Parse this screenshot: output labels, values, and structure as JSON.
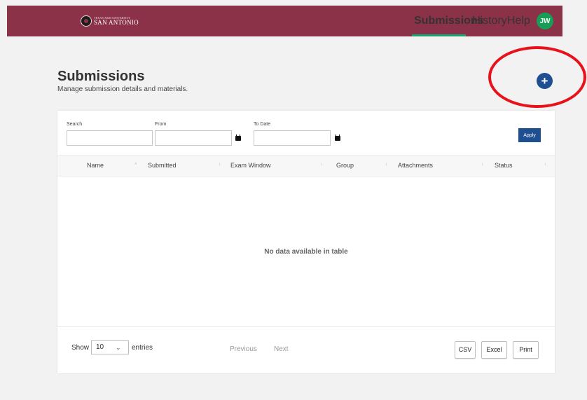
{
  "header": {
    "logo_small": "Texas A&M University",
    "logo_main": "SAN ANTONIO",
    "nav": {
      "submissions": "Submissions",
      "history": "History",
      "help": "Help"
    },
    "user_initials": "JW",
    "colors": {
      "bar": "#8c3248",
      "active": "#17a673",
      "avatar": "#159e55"
    }
  },
  "page": {
    "title": "Submissions",
    "subtitle": "Manage submission details and materials.",
    "add_button": "+"
  },
  "filters": {
    "search_label": "Search",
    "from_label": "From",
    "to_label": "To Date",
    "search_value": "",
    "from_value": "",
    "to_value": "",
    "apply_label": "Apply"
  },
  "table": {
    "columns": [
      "Name",
      "Submitted",
      "Exam Window",
      "Group",
      "Attachments",
      "Status"
    ],
    "rows": [],
    "empty_message": "No data available in table"
  },
  "footer": {
    "show_label": "Show",
    "page_length": "10",
    "entries_label": "entries",
    "previous": "Previous",
    "next": "Next",
    "export_buttons": [
      "CSV",
      "Excel",
      "Print"
    ]
  },
  "icons": {
    "sort": "↕",
    "sort_asc": "˄",
    "caret": "⌄"
  }
}
